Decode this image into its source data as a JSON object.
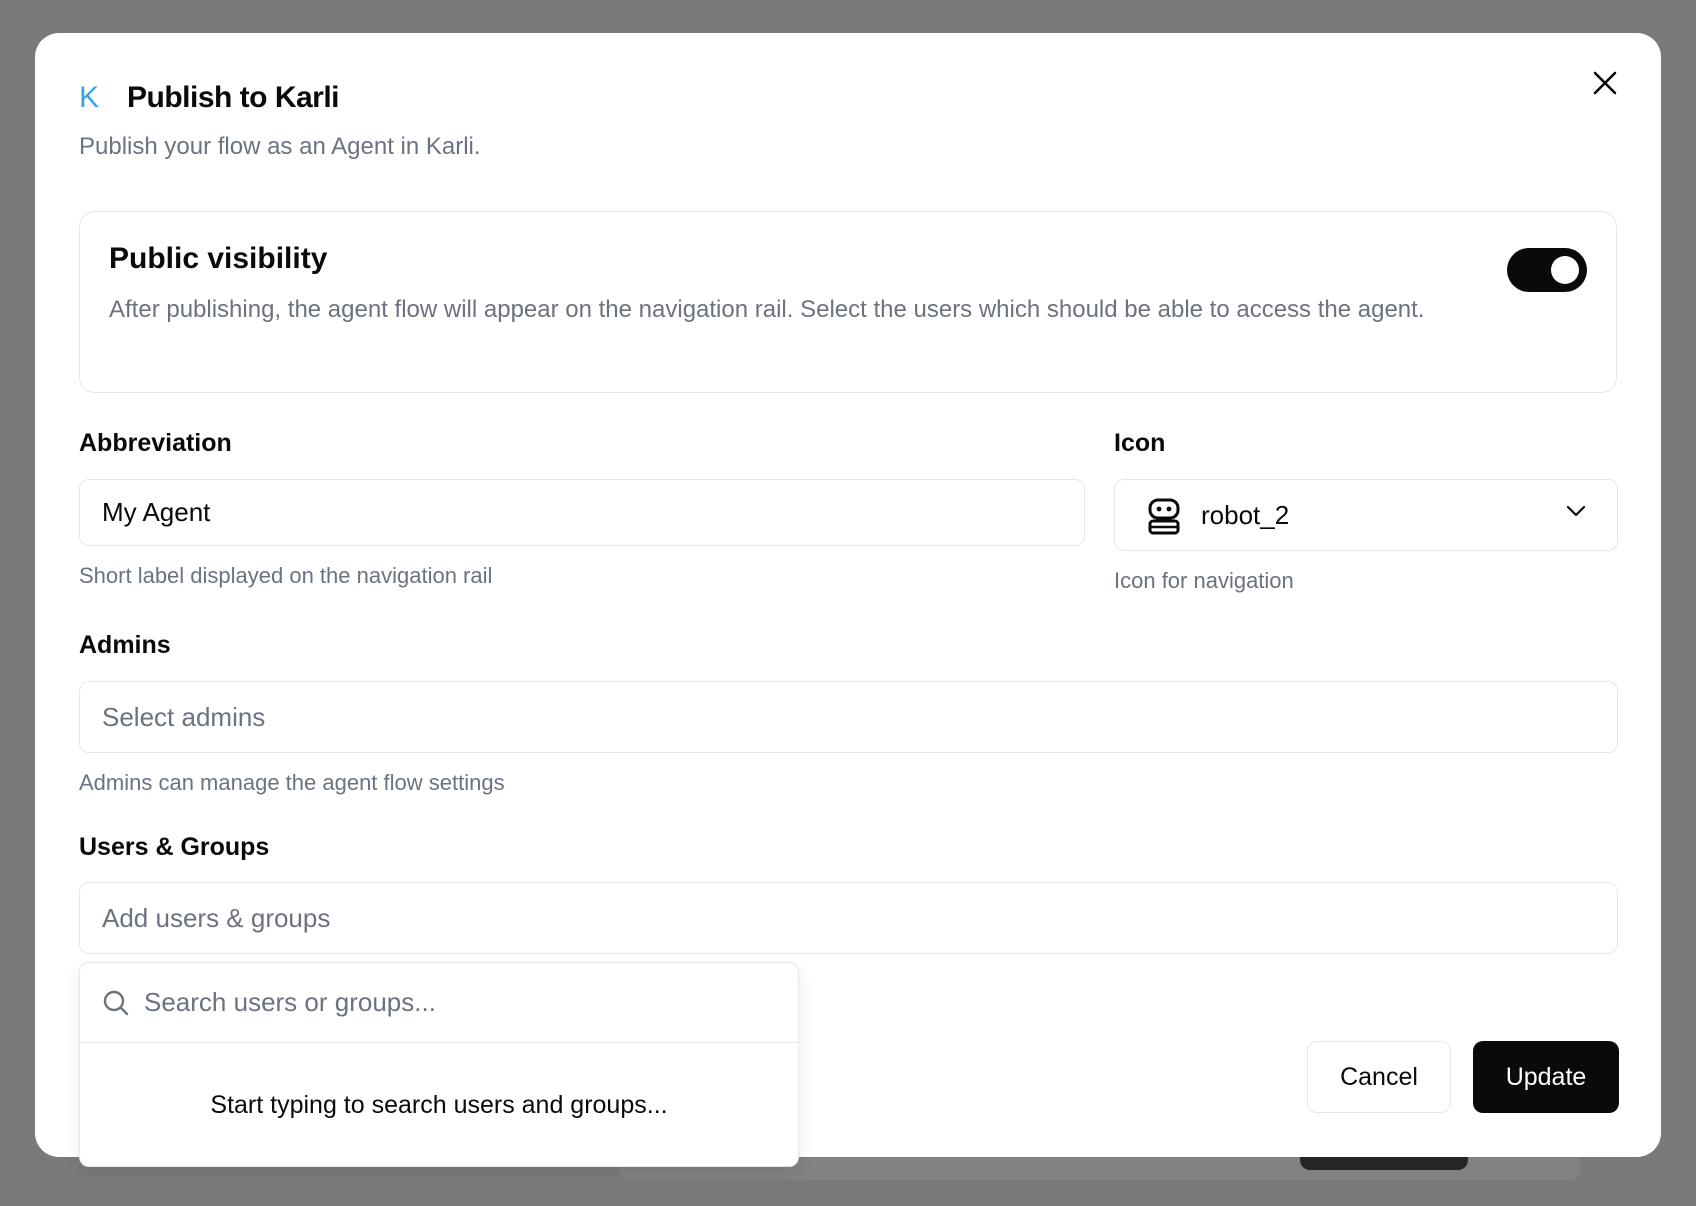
{
  "dialog": {
    "logo_letter": "K",
    "title": "Publish to Karli",
    "subtitle": "Publish your flow as an Agent in Karli.",
    "close_icon": "close-icon"
  },
  "visibility": {
    "title": "Public visibility",
    "description": "After publishing, the agent flow will appear on the navigation rail. Select the users which should be able to access the agent.",
    "enabled": true
  },
  "abbreviation": {
    "label": "Abbreviation",
    "value": "My Agent",
    "helper": "Short label displayed on the navigation rail"
  },
  "icon_field": {
    "label": "Icon",
    "value": "robot_2",
    "icon": "robot-icon",
    "helper": "Icon for navigation"
  },
  "admins": {
    "label": "Admins",
    "placeholder": "Select admins",
    "helper": "Admins can manage the agent flow settings"
  },
  "users_groups": {
    "label": "Users & Groups",
    "placeholder": "Add users & groups",
    "search_placeholder": "Search users or groups...",
    "empty_message": "Start typing to search users and groups..."
  },
  "actions": {
    "cancel_label": "Cancel",
    "update_label": "Update"
  },
  "colors": {
    "accent": "#3aa0e8",
    "primary": "#0a0a0a",
    "muted_text": "#6b7280",
    "border": "#e5e7eb",
    "overlay": "#7a7a7a"
  }
}
